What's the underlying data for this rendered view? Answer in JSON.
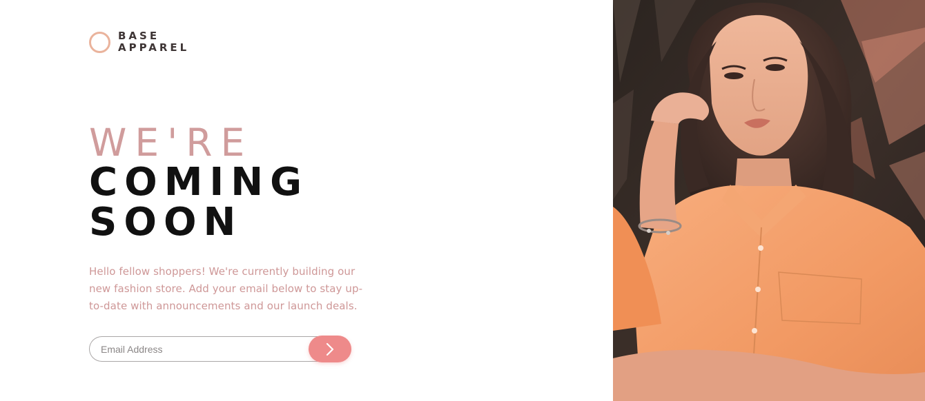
{
  "brand": {
    "line1": "BASE",
    "line2": "APPAREL",
    "accent_color": "#eab39c",
    "logo_icon": "ring-icon"
  },
  "headline": {
    "light": "WE'RE",
    "dark_line1": "COMING",
    "dark_line2": "SOON"
  },
  "intro_text": "Hello fellow shoppers! We're currently building our new fashion store. Add your email below to stay up-to-date with announcements and our launch deals.",
  "signup": {
    "placeholder": "Email Address",
    "submit_icon": "chevron-right-icon",
    "button_color": "#ee8a8a"
  },
  "hero": {
    "image_subject": "model-photo",
    "shirt_color": "#f5a26f"
  },
  "colors": {
    "primary_text": "#ce9797",
    "dark_text": "#111111"
  }
}
